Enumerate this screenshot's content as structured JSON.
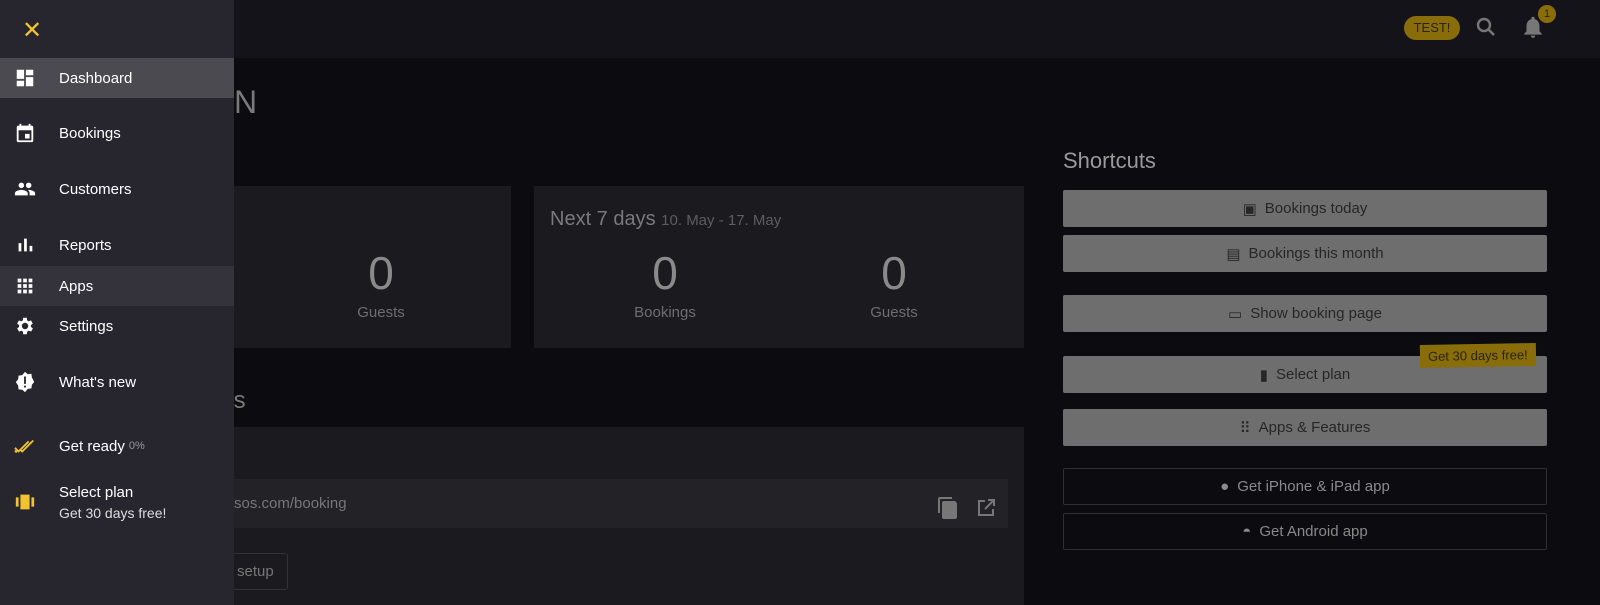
{
  "topbar": {
    "test_badge": "TEST!",
    "notification_count": "1"
  },
  "main": {
    "title_fragment": "N",
    "card_left": {
      "guests_value": "0",
      "guests_label": "Guests"
    },
    "card_next7": {
      "title": "Next 7 days",
      "range": "10. May - 17. May",
      "bookings_value": "0",
      "bookings_label": "Bookings",
      "guests_value": "0",
      "guests_label": "Guests"
    },
    "section_fragment": "ts",
    "booking_url_fragment": "sos.com/booking",
    "setup_fragment": "setup"
  },
  "shortcuts": {
    "title": "Shortcuts",
    "promo": "Get 30 days free!",
    "buttons": [
      {
        "label": "Bookings today",
        "icon": "calendar-today-icon"
      },
      {
        "label": "Bookings this month",
        "icon": "calendar-month-icon"
      },
      {
        "label": "Show booking page",
        "icon": "devices-icon"
      },
      {
        "label": "Select plan",
        "icon": "plan-icon"
      },
      {
        "label": "Apps & Features",
        "icon": "apps-icon"
      },
      {
        "label": "Get iPhone & iPad app",
        "icon": "apple-icon"
      },
      {
        "label": "Get Android app",
        "icon": "android-icon"
      }
    ]
  },
  "sidebar": {
    "items": [
      {
        "label": "Dashboard",
        "icon": "dashboard-icon"
      },
      {
        "label": "Bookings",
        "icon": "calendar-icon"
      },
      {
        "label": "Customers",
        "icon": "people-icon"
      },
      {
        "label": "Reports",
        "icon": "bar-chart-icon"
      },
      {
        "label": "Apps",
        "icon": "apps-icon"
      },
      {
        "label": "Settings",
        "icon": "gear-icon"
      },
      {
        "label": "What's new",
        "icon": "alert-badge-icon"
      },
      {
        "label": "Get ready",
        "icon": "double-check-icon",
        "progress": "0%"
      },
      {
        "label": "Select plan",
        "icon": "plan-icon",
        "sub": "Get 30 days free!"
      }
    ]
  },
  "colors": {
    "accent": "#f2c230",
    "sidebar": "#27262f",
    "active": "#4b4a51"
  }
}
